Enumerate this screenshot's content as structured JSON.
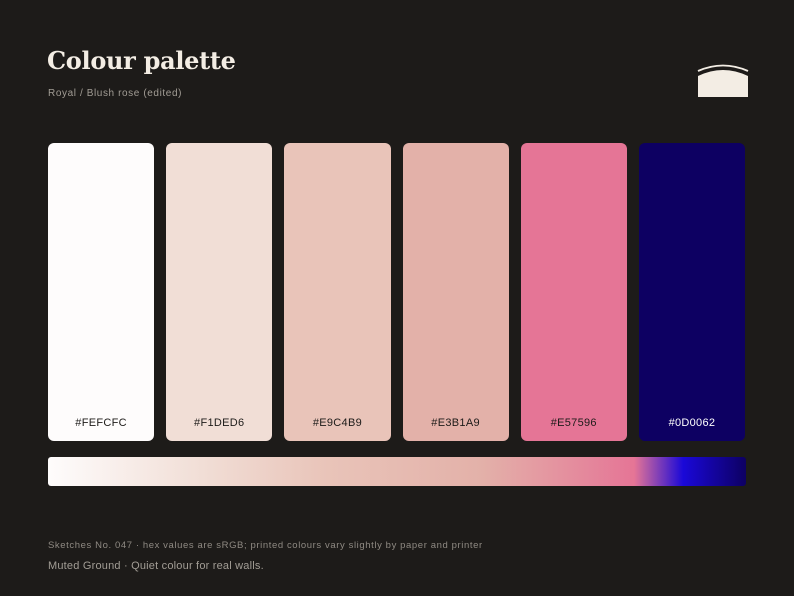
{
  "header": {
    "title": "Colour palette",
    "subtitle": "Royal / Blush rose (edited)",
    "logo_icon": "arch-icon",
    "logo_color": "#F3EDE4"
  },
  "palette": [
    {
      "hex": "#FEFCFC",
      "label_color": "#1D1B19"
    },
    {
      "hex": "#F1DED6",
      "label_color": "#1D1B19"
    },
    {
      "hex": "#E9C4B9",
      "label_color": "#1D1B19"
    },
    {
      "hex": "#E3B1A9",
      "label_color": "#1D1B19"
    },
    {
      "hex": "#E57596",
      "label_color": "#1D1B19"
    },
    {
      "hex": "#0D0062",
      "label_color": "#FFFFFF"
    }
  ],
  "gradient": {
    "stops": [
      "#FEFCFC",
      "#F1DED6",
      "#E9C4B9",
      "#E3B1A9",
      "#E57596",
      "#1A08D8",
      "#0D0062"
    ]
  },
  "footer": {
    "note": "Sketches No. 047 · hex values are sRGB; printed colours vary slightly by paper and printer",
    "tagline": "Muted Ground · Quiet colour for real walls."
  },
  "theme": {
    "background": "#1D1B19"
  }
}
